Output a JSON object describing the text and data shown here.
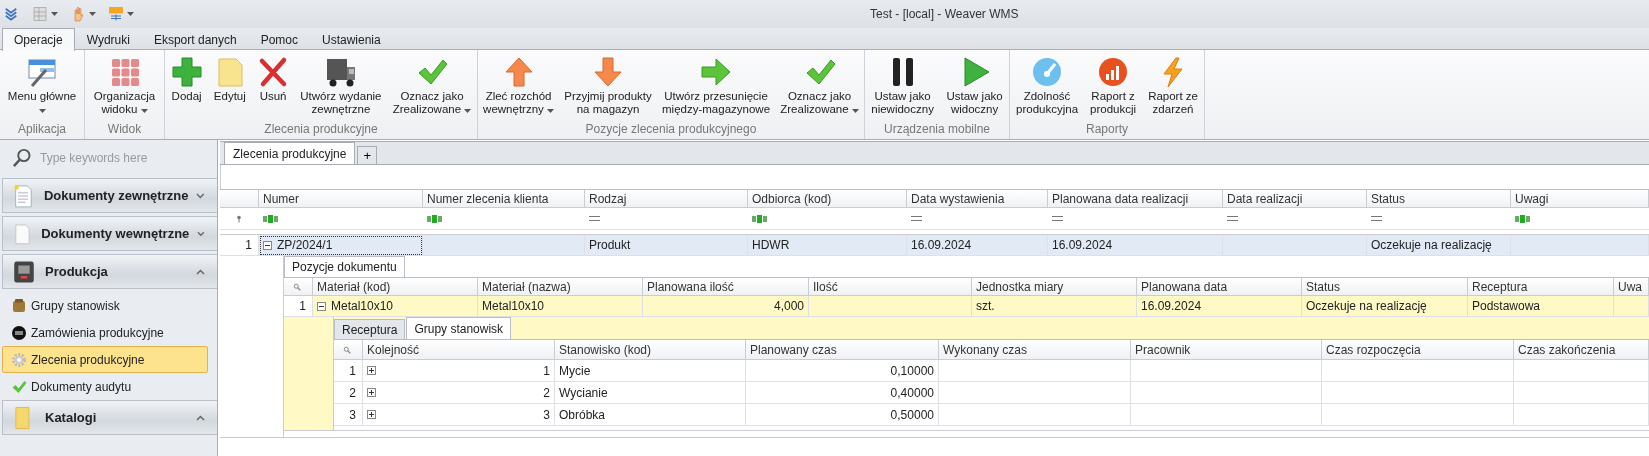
{
  "window": {
    "title": "Test - [local] - Weaver WMS"
  },
  "ribbon": {
    "tabs": [
      {
        "label": "Operacje",
        "selected": true
      },
      {
        "label": "Wydruki",
        "selected": false
      },
      {
        "label": "Eksport danych",
        "selected": false
      },
      {
        "label": "Pomoc",
        "selected": false
      },
      {
        "label": "Ustawienia",
        "selected": false
      }
    ],
    "groups": [
      {
        "caption": "Aplikacja",
        "buttons": [
          {
            "label": "Menu główne",
            "dropdown": true
          }
        ]
      },
      {
        "caption": "Widok",
        "buttons": [
          {
            "label": "Organizacja\nwidoku",
            "dropdown": true
          }
        ]
      },
      {
        "caption": "Zlecenia produkcyjne",
        "buttons": [
          {
            "label": "Dodaj",
            "dropdown": false
          },
          {
            "label": "Edytuj",
            "dropdown": false
          },
          {
            "label": "Usuń",
            "dropdown": false
          },
          {
            "label": "Utwórz wydanie\nzewnętrzne",
            "dropdown": false
          },
          {
            "label": "Oznacz jako\nZrealizowane",
            "dropdown": true
          }
        ]
      },
      {
        "caption": "Pozycje zlecenia produkcyjnego",
        "buttons": [
          {
            "label": "Zleć rozchód\nwewnętrzny",
            "dropdown": true
          },
          {
            "label": "Przyjmij produkty\nna magazyn",
            "dropdown": false
          },
          {
            "label": "Utwórz przesunięcie\nmiędzy-magazynowe",
            "dropdown": false
          },
          {
            "label": "Oznacz jako\nZrealizowane",
            "dropdown": true
          }
        ]
      },
      {
        "caption": "Urządzenia mobilne",
        "buttons": [
          {
            "label": "Ustaw jako\nniewidoczny",
            "dropdown": false
          },
          {
            "label": "Ustaw jako\nwidoczny",
            "dropdown": false
          }
        ]
      },
      {
        "caption": "Raporty",
        "buttons": [
          {
            "label": "Zdolność\nprodukcyjna",
            "dropdown": false
          },
          {
            "label": "Raport z\nprodukcji",
            "dropdown": false
          },
          {
            "label": "Raport ze\nzdarzeń",
            "dropdown": false
          }
        ]
      }
    ]
  },
  "sidebar": {
    "search": {
      "placeholder": "Type keywords here"
    },
    "groups": [
      {
        "label": "Dokumenty zewnętrzne",
        "expanded": false
      },
      {
        "label": "Dokumenty wewnętrzne",
        "expanded": false
      },
      {
        "label": "Produkcja",
        "expanded": true,
        "items": [
          {
            "label": "Grupy stanowisk",
            "selected": false
          },
          {
            "label": "Zamówienia produkcyjne",
            "selected": false
          },
          {
            "label": "Zlecenia produkcyjne",
            "selected": true
          },
          {
            "label": "Dokumenty audytu",
            "selected": false
          }
        ]
      },
      {
        "label": "Katalogi",
        "expanded": true
      }
    ]
  },
  "document_tabs": [
    {
      "label": "Zlecenia produkcyjne",
      "selected": true
    }
  ],
  "new_tab_button": {
    "label": "+"
  },
  "orders_grid": {
    "columns": [
      {
        "label": "Numer",
        "filter": {
          "kind": "text"
        }
      },
      {
        "label": "Numer zlecenia klienta",
        "filter": {
          "kind": "text"
        }
      },
      {
        "label": "Rodzaj",
        "filter": {
          "kind": "equals"
        }
      },
      {
        "label": "Odbiorca (kod)",
        "filter": {
          "kind": "text"
        }
      },
      {
        "label": "Data wystawienia",
        "filter": {
          "kind": "equals"
        }
      },
      {
        "label": "Planowana data realizacji",
        "filter": {
          "kind": "equals"
        }
      },
      {
        "label": "Data realizacji",
        "filter": {
          "kind": "equals"
        }
      },
      {
        "label": "Status",
        "filter": {
          "kind": "equals"
        }
      },
      {
        "label": "Uwagi",
        "filter": {
          "kind": "text"
        }
      }
    ],
    "rows": [
      {
        "number": "1",
        "selected": true,
        "expanded": true,
        "cells": [
          "ZP/2024/1",
          null,
          "Produkt",
          "HDWR",
          "16.09.2024",
          "16.09.2024",
          null,
          "Oczekuje na realizację",
          null
        ],
        "detail": {
          "tabs": [
            {
              "label": "Pozycje dokumentu",
              "selected": true
            }
          ],
          "grid": {
            "columns": [
              {
                "label": "Materiał (kod)"
              },
              {
                "label": "Materiał (nazwa)"
              },
              {
                "label": "Planowana ilość"
              },
              {
                "label": "Ilość"
              },
              {
                "label": "Jednostka miary"
              },
              {
                "label": "Planowana data"
              },
              {
                "label": "Status"
              },
              {
                "label": "Receptura"
              },
              {
                "label": "Uwa"
              }
            ],
            "rows": [
              {
                "number": "1",
                "selected": true,
                "expanded": true,
                "cells": [
                  "Metal10x10",
                  "Metal10x10",
                  "4,000",
                  null,
                  "szt.",
                  "16.09.2024",
                  "Oczekuje na realizację",
                  "Podstawowa",
                  null
                ],
                "detail": {
                  "tabs": [
                    {
                      "label": "Receptura",
                      "selected": false
                    },
                    {
                      "label": "Grupy stanowisk",
                      "selected": true
                    }
                  ],
                  "grid": {
                    "columns": [
                      {
                        "label": "Kolejność"
                      },
                      {
                        "label": "Stanowisko (kod)"
                      },
                      {
                        "label": "Planowany czas"
                      },
                      {
                        "label": "Wykonany czas"
                      },
                      {
                        "label": "Pracownik"
                      },
                      {
                        "label": "Czas rozpoczęcia"
                      },
                      {
                        "label": "Czas zakończenia"
                      }
                    ],
                    "rows": [
                      {
                        "number": "1",
                        "selected": false,
                        "expanded": false,
                        "cells": [
                          "1",
                          "Mycie",
                          "0,10000",
                          null,
                          null,
                          null,
                          null
                        ]
                      },
                      {
                        "number": "2",
                        "selected": false,
                        "expanded": false,
                        "cells": [
                          "2",
                          "Wycianie",
                          "0,40000",
                          null,
                          null,
                          null,
                          null
                        ]
                      },
                      {
                        "number": "3",
                        "selected": false,
                        "expanded": false,
                        "cells": [
                          "3",
                          "Obróbka",
                          "0,50000",
                          null,
                          null,
                          null,
                          null
                        ]
                      }
                    ]
                  }
                }
              }
            ]
          }
        }
      }
    ]
  }
}
